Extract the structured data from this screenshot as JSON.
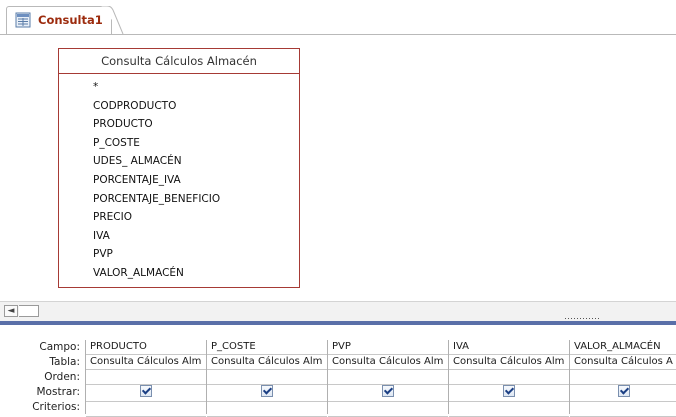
{
  "tab": {
    "label": "Consulta1",
    "icon": "query-design-icon"
  },
  "table": {
    "title": "Consulta Cálculos Almacén",
    "fields": [
      "*",
      "CODPRODUCTO",
      "PRODUCTO",
      "P_COSTE",
      "UDES_ ALMACÉN",
      "PORCENTAJE_IVA",
      "PORCENTAJE_BENEFICIO",
      "PRECIO",
      "IVA",
      "PVP",
      "VALOR_ALMACÉN"
    ]
  },
  "scrollbar": {
    "left_arrow": "◄"
  },
  "grid": {
    "row_labels": {
      "campo": "Campo:",
      "tabla": "Tabla:",
      "orden": "Orden:",
      "mostrar": "Mostrar:",
      "criterios": "Criterios:"
    },
    "columns": [
      {
        "campo": "PRODUCTO",
        "tabla": "Consulta Cálculos Alm",
        "orden": "",
        "mostrar": true,
        "criterios": ""
      },
      {
        "campo": "P_COSTE",
        "tabla": "Consulta Cálculos Alm",
        "orden": "",
        "mostrar": true,
        "criterios": ""
      },
      {
        "campo": "PVP",
        "tabla": "Consulta Cálculos Alm",
        "orden": "",
        "mostrar": true,
        "criterios": ""
      },
      {
        "campo": "IVA",
        "tabla": "Consulta Cálculos Alm",
        "orden": "",
        "mostrar": true,
        "criterios": ""
      },
      {
        "campo": "VALOR_ALMACÉN",
        "tabla": "Consulta Cálculos A",
        "orden": "",
        "mostrar": true,
        "criterios": ""
      }
    ]
  },
  "colors": {
    "tab_text": "#9c2b0d",
    "table_border": "#a63a35",
    "splitter": "#5a6fa8"
  }
}
